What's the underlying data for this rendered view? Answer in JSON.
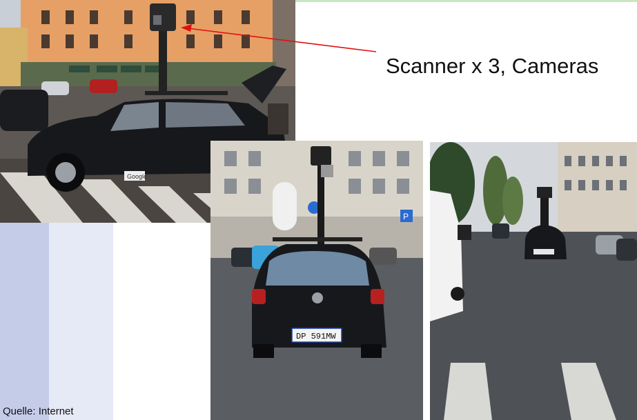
{
  "slide": {
    "caption": "Scanner x 3, Cameras",
    "source": "Quelle: Internet"
  },
  "photos": {
    "photo1": {
      "plate_sticker": "Google"
    },
    "photo2": {
      "license_plate": "DP 591MW"
    }
  },
  "colors": {
    "arrow": "#e01010",
    "car": "#111318",
    "band_dark": "#c4cce8",
    "band_light": "#e6eaf7"
  }
}
